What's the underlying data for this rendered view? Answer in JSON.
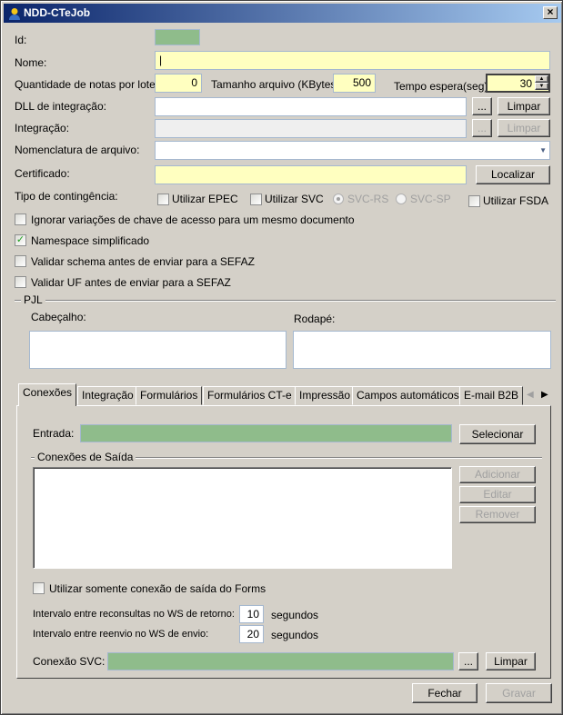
{
  "window": {
    "title": "NDD-CTeJob",
    "close": "×"
  },
  "form": {
    "id_label": "Id:",
    "nome_label": "Nome:",
    "nome_value": "|",
    "qtd_label": "Quantidade de notas por lote:",
    "qtd_value": "0",
    "tamanho_label": "Tamanho arquivo (KBytes):",
    "tamanho_value": "500",
    "tempo_label": "Tempo espera(seg):",
    "tempo_value": "30",
    "dll_label": "DLL de integração:",
    "integracao_label": "Integração:",
    "browse": "...",
    "limpar": "Limpar",
    "nomenclatura_label": "Nomenclatura de arquivo:",
    "certificado_label": "Certificado:",
    "localizar": "Localizar",
    "contingencia_label": "Tipo de contingência:",
    "epec": "Utilizar EPEC",
    "svc": "Utilizar SVC",
    "svc_rs": "SVC-RS",
    "svc_sp": "SVC-SP",
    "fsda": "Utilizar FSDA",
    "options": [
      {
        "label": "Ignorar variações de chave de acesso para um mesmo documento",
        "checked": false
      },
      {
        "label": "Namespace simplificado",
        "checked": true
      },
      {
        "label": "Validar schema antes de enviar para a SEFAZ",
        "checked": false
      },
      {
        "label": "Validar UF antes de enviar para a SEFAZ",
        "checked": false
      }
    ],
    "pjl_label": "PJL",
    "cabecalho_label": "Cabeçalho:",
    "rodape_label": "Rodapé:"
  },
  "tabs": [
    "Conexões",
    "Integração",
    "Formulários",
    "Formulários CT-e",
    "Impressão",
    "Campos automáticos",
    "E-mail B2B"
  ],
  "conexoes": {
    "entrada_label": "Entrada:",
    "selecionar": "Selecionar",
    "saida_label": "Conexões de Saída",
    "adicionar": "Adicionar",
    "editar": "Editar",
    "remover": "Remover",
    "somente_forms": "Utilizar somente conexão de saída do Forms",
    "reconsultas_label": "Intervalo entre reconsultas no WS de retorno:",
    "reconsultas_value": "10",
    "reenvio_label": "Intervalo entre reenvio no WS de envio:",
    "reenvio_value": "20",
    "segundos": "segundos",
    "svc_label": "Conexão SVC:",
    "browse": "...",
    "limpar": "Limpar"
  },
  "footer": {
    "fechar": "Fechar",
    "gravar": "Gravar"
  }
}
